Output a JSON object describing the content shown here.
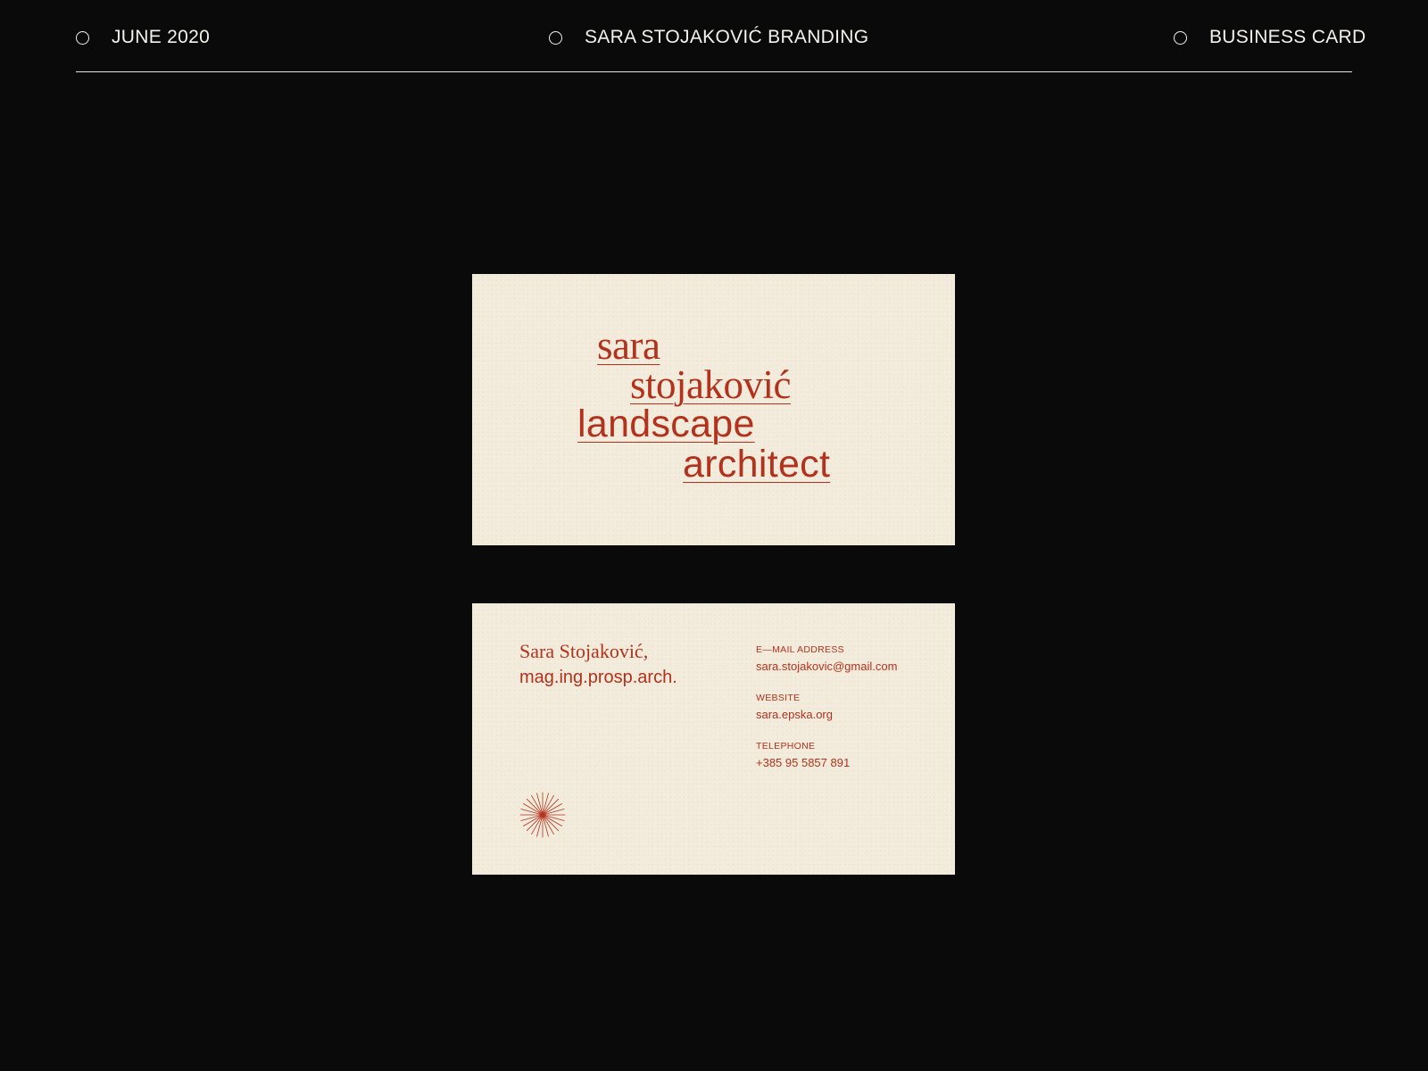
{
  "header": {
    "date": "JUNE 2020",
    "project": "SARA STOJAKOVIĆ BRANDING",
    "item": "BUSINESS CARD"
  },
  "card_front": {
    "line1": "sara",
    "line2": "stojaković",
    "line3": "landscape",
    "line4": "architect"
  },
  "card_back": {
    "name": "Sara Stojaković,",
    "title": "mag.ing.prosp.arch.",
    "contacts": [
      {
        "label": "E—MAIL ADDRESS",
        "value": "sara.stojakovic@gmail.com"
      },
      {
        "label": "WEBSITE",
        "value": "sara.epska.org"
      },
      {
        "label": "TELEPHONE",
        "value": "+385 95 5857 891"
      }
    ],
    "logo_icon": "starburst-icon"
  },
  "colors": {
    "background": "#0a0a0a",
    "card": "#f3ecdc",
    "accent": "#b3321d",
    "header_text": "#f2f1ee"
  }
}
